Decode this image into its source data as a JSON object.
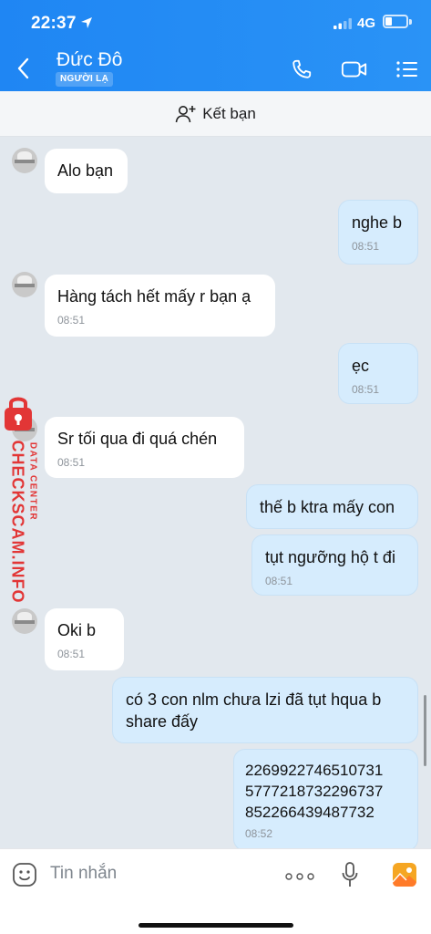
{
  "status_bar": {
    "time": "22:37",
    "network": "4G"
  },
  "header": {
    "contact_name": "Đức Đô",
    "stranger_tag": "NGƯỜI LẠ"
  },
  "friend_bar": {
    "label": "Kết bạn"
  },
  "messages": [
    {
      "side": "in",
      "text": "Alo bạn",
      "time": ""
    },
    {
      "side": "out",
      "text": "nghe b",
      "time": "08:51"
    },
    {
      "side": "in",
      "text": "Hàng tách hết mấy r bạn ạ",
      "time": "08:51"
    },
    {
      "side": "out",
      "text": "ẹc",
      "time": "08:51"
    },
    {
      "side": "in",
      "text": "Sr tối qua đi quá chén",
      "time": "08:51"
    },
    {
      "side": "out",
      "text": "thế b ktra mấy con",
      "time": ""
    },
    {
      "side": "out",
      "text": "tụt ngưỡng hộ t đi",
      "time": "08:51"
    },
    {
      "side": "in",
      "text": "Oki b",
      "time": "08:51"
    },
    {
      "side": "out",
      "text": "có 3 con nlm chưa lzi đã tụt hqua b share đấy",
      "time": ""
    },
    {
      "side": "out",
      "text": "226992274651073157772187322967378522664394877 32",
      "time": "08:52"
    }
  ],
  "code_lines": [
    "2269922746510731",
    "5777218732296737",
    "852266439487732"
  ],
  "watermark": {
    "big": "CHECKSCAM.INFO",
    "small": "DATA CENTER"
  },
  "input_bar": {
    "placeholder": "Tin nhắn"
  },
  "colors": {
    "header": "#2a8ff5",
    "outgoing_bubble": "#d6ecfd",
    "incoming_bubble": "#ffffff",
    "background": "#e2e8ee",
    "watermark": "#e23636"
  },
  "icons": [
    "back-arrow-icon",
    "phone-icon",
    "video-call-icon",
    "menu-list-icon",
    "add-friend-icon",
    "emoji-icon",
    "more-icon",
    "microphone-icon",
    "gallery-icon"
  ]
}
